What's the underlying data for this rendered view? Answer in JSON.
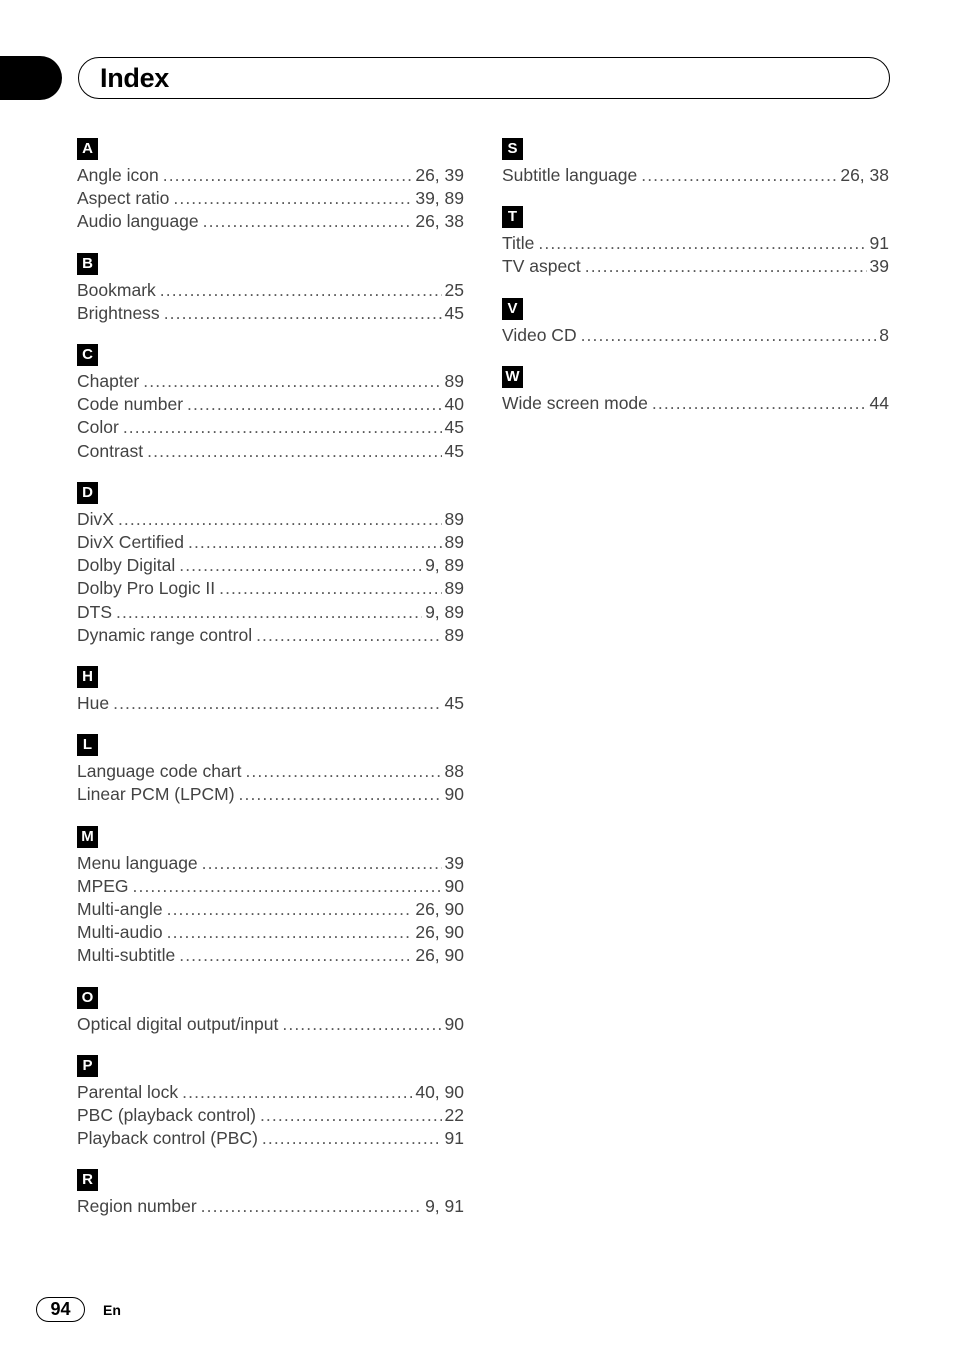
{
  "header": {
    "title": "Index"
  },
  "footer": {
    "page_number": "94",
    "language_code": "En"
  },
  "columns": [
    {
      "id": "left",
      "sections": [
        {
          "letter": "A",
          "entries": [
            {
              "label": "Angle icon",
              "pages": "26, 39"
            },
            {
              "label": "Aspect ratio",
              "pages": "39, 89"
            },
            {
              "label": "Audio language",
              "pages": "26, 38"
            }
          ]
        },
        {
          "letter": "B",
          "entries": [
            {
              "label": "Bookmark",
              "pages": "25"
            },
            {
              "label": "Brightness",
              "pages": "45"
            }
          ]
        },
        {
          "letter": "C",
          "entries": [
            {
              "label": "Chapter",
              "pages": "89"
            },
            {
              "label": "Code number",
              "pages": "40"
            },
            {
              "label": "Color",
              "pages": "45"
            },
            {
              "label": "Contrast",
              "pages": "45"
            }
          ]
        },
        {
          "letter": "D",
          "entries": [
            {
              "label": "DivX",
              "pages": "89"
            },
            {
              "label": "DivX Certified",
              "pages": "89"
            },
            {
              "label": "Dolby Digital",
              "pages": "9, 89"
            },
            {
              "label": "Dolby Pro Logic II",
              "pages": "89"
            },
            {
              "label": "DTS",
              "pages": "9, 89"
            },
            {
              "label": "Dynamic range control",
              "pages": "89"
            }
          ]
        },
        {
          "letter": "H",
          "entries": [
            {
              "label": "Hue",
              "pages": "45"
            }
          ]
        },
        {
          "letter": "L",
          "entries": [
            {
              "label": "Language code chart",
              "pages": "88"
            },
            {
              "label": "Linear PCM (LPCM)",
              "pages": "90"
            }
          ]
        },
        {
          "letter": "M",
          "entries": [
            {
              "label": "Menu language",
              "pages": "39"
            },
            {
              "label": "MPEG",
              "pages": "90"
            },
            {
              "label": "Multi-angle",
              "pages": "26, 90"
            },
            {
              "label": "Multi-audio",
              "pages": "26, 90"
            },
            {
              "label": "Multi-subtitle",
              "pages": "26, 90"
            }
          ]
        },
        {
          "letter": "O",
          "entries": [
            {
              "label": "Optical digital output/input",
              "pages": "90"
            }
          ]
        },
        {
          "letter": "P",
          "entries": [
            {
              "label": "Parental lock",
              "pages": "40, 90"
            },
            {
              "label": "PBC (playback control)",
              "pages": "22"
            },
            {
              "label": "Playback control (PBC)",
              "pages": "91"
            }
          ]
        },
        {
          "letter": "R",
          "entries": [
            {
              "label": "Region number",
              "pages": "9, 91"
            }
          ]
        }
      ]
    },
    {
      "id": "right",
      "sections": [
        {
          "letter": "S",
          "entries": [
            {
              "label": "Subtitle language",
              "pages": "26, 38"
            }
          ]
        },
        {
          "letter": "T",
          "entries": [
            {
              "label": "Title",
              "pages": "91"
            },
            {
              "label": "TV aspect",
              "pages": "39"
            }
          ]
        },
        {
          "letter": "V",
          "entries": [
            {
              "label": "Video CD",
              "pages": "8"
            }
          ]
        },
        {
          "letter": "W",
          "entries": [
            {
              "label": "Wide screen mode",
              "pages": "44"
            }
          ]
        }
      ]
    }
  ]
}
